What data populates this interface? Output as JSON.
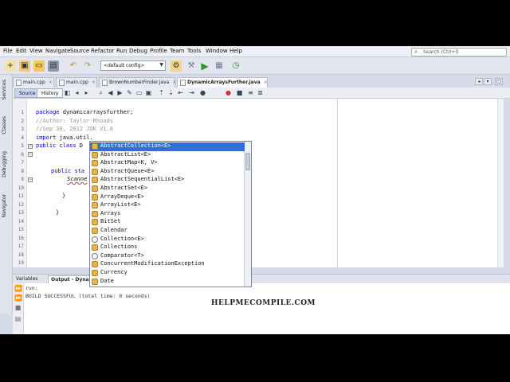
{
  "menu": [
    "File",
    "Edit",
    "View",
    "Navigate",
    "Source",
    "Refactor",
    "Run",
    "Debug",
    "Profile",
    "Team",
    "Tools",
    "Window",
    "Help"
  ],
  "search": {
    "placeholder": "Search (Ctrl+I)"
  },
  "toolbar": {
    "config": "<default config>"
  },
  "left_panel": {
    "services": "Services",
    "classes": "Classes",
    "debugging": "Debugging",
    "navigator": "Navigator"
  },
  "editor_tabs": [
    "main.cpp",
    "main.cpp",
    "BrownNumberFinder.java",
    "DynamicArraysFurther.java"
  ],
  "editor_toolbar": {
    "source": "Source",
    "history": "History"
  },
  "line_numbers": [
    "1",
    "2",
    "3",
    "4",
    "5",
    "6",
    "7",
    "8",
    "9",
    "10",
    "11",
    "12",
    "13",
    "14",
    "15",
    "16",
    "17",
    "18",
    "19",
    "20"
  ],
  "code": {
    "line2_kw": "package",
    "line2_rest": " dynamicarraysfurther;",
    "line3": "//Author: Taylor Rhoads",
    "line4": "//Sep 30, 2012 JDK V1.6",
    "line5_kw": "import",
    "line5_rest": " java.util.",
    "line6_kw": "public class",
    "line6_rest": " D",
    "line9_kw": "public sta",
    "line10": "Scanne",
    "line12": "}",
    "line14": "}"
  },
  "completion": [
    {
      "label": "AbstractCollection<E>",
      "kind": "class"
    },
    {
      "label": "AbstractList<E>",
      "kind": "class"
    },
    {
      "label": "AbstractMap<K, V>",
      "kind": "class"
    },
    {
      "label": "AbstractQueue<E>",
      "kind": "class"
    },
    {
      "label": "AbstractSequentialList<E>",
      "kind": "class"
    },
    {
      "label": "AbstractSet<E>",
      "kind": "class"
    },
    {
      "label": "ArrayDeque<E>",
      "kind": "class"
    },
    {
      "label": "ArrayList<E>",
      "kind": "class"
    },
    {
      "label": "Arrays",
      "kind": "class"
    },
    {
      "label": "BitSet",
      "kind": "class"
    },
    {
      "label": "Calendar",
      "kind": "class"
    },
    {
      "label": "Collection<E>",
      "kind": "interface"
    },
    {
      "label": "Collections",
      "kind": "class"
    },
    {
      "label": "Comparator<T>",
      "kind": "interface"
    },
    {
      "label": "ConcurrentModificationException",
      "kind": "class"
    },
    {
      "label": "Currency",
      "kind": "class"
    },
    {
      "label": "Date",
      "kind": "class"
    }
  ],
  "output_tabs": {
    "variables": "Variables",
    "output": "Output - Dynam"
  },
  "output_lines": [
    "run:",
    "BUILD SUCCESSFUL (total time: 0 seconds)"
  ],
  "watermark": "HELPMECOMPILE.COM"
}
